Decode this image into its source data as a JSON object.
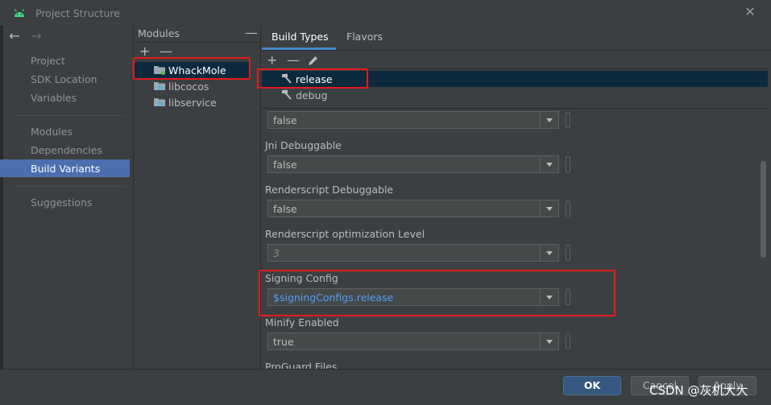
{
  "window": {
    "title": "Project Structure",
    "close_glyph": "✕"
  },
  "nav": {
    "back_glyph": "←",
    "forward_glyph": "→",
    "items": [
      {
        "label": "Project"
      },
      {
        "label": "SDK Location"
      },
      {
        "label": "Variables"
      },
      {
        "label": "Modules"
      },
      {
        "label": "Dependencies"
      },
      {
        "label": "Build Variants"
      },
      {
        "label": "Suggestions"
      }
    ],
    "selected": "Build Variants"
  },
  "modules": {
    "header": "Modules",
    "collapse_glyph": "—",
    "add_glyph": "+",
    "remove_glyph": "—",
    "items": [
      {
        "label": "WhackMole",
        "icon": "app-module-folder-icon"
      },
      {
        "label": "libcocos",
        "icon": "library-module-folder-icon"
      },
      {
        "label": "libservice",
        "icon": "library-module-folder-icon"
      }
    ],
    "selected": "WhackMole"
  },
  "tabs": [
    {
      "label": "Build Types"
    },
    {
      "label": "Flavors"
    }
  ],
  "active_tab": "Build Types",
  "build_types": {
    "add_glyph": "+",
    "remove_glyph": "—",
    "edit_icon": "pencil-icon",
    "items": [
      {
        "label": "release",
        "icon": "hammer-icon"
      },
      {
        "label": "debug",
        "icon": "hammer-icon"
      }
    ],
    "selected": "release"
  },
  "form": {
    "fields": [
      {
        "label": "",
        "value": "false"
      },
      {
        "label": "Jni Debuggable",
        "value": "false"
      },
      {
        "label": "Renderscript Debuggable",
        "value": "false"
      },
      {
        "label": "Renderscript optimization Level",
        "value": "3"
      },
      {
        "label": "Signing Config",
        "value": "$signingConfigs.release"
      },
      {
        "label": "Minify Enabled",
        "value": "true"
      },
      {
        "label": "ProGuard Files"
      }
    ]
  },
  "buttons": {
    "ok": "OK",
    "cancel": "Cancel",
    "apply": "Apply"
  },
  "watermark": "CSDN @灰机大大",
  "colors": {
    "accent": "#4b6eaf",
    "highlight": "#e21c1c",
    "link": "#589df6",
    "selection": "#0d293e"
  }
}
